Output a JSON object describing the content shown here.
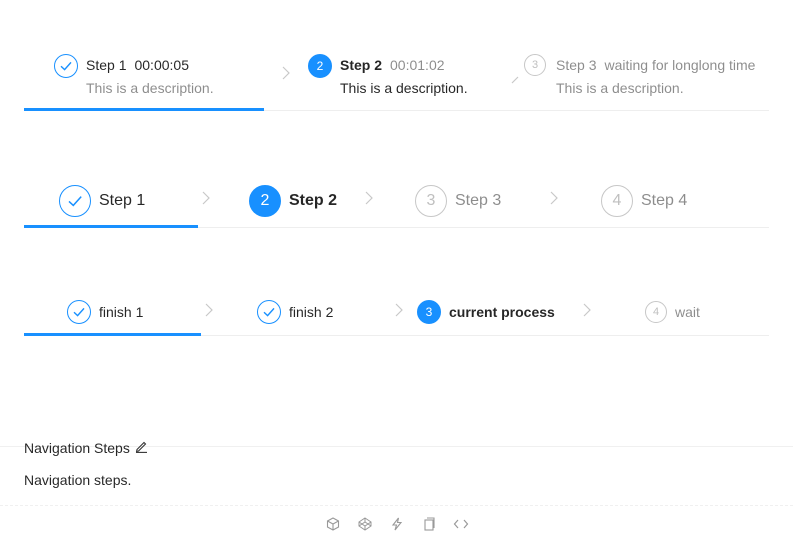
{
  "colors": {
    "primary": "#1890ff",
    "wait": "#bfbfbf",
    "divider": "#eeeeee"
  },
  "row1": {
    "steps": [
      {
        "status": "finish",
        "title": "Step 1",
        "subtitle": "00:00:05",
        "description": "This is a description.",
        "icon": "check-icon"
      },
      {
        "status": "process",
        "number": "2",
        "title": "Step 2",
        "subtitle": "00:01:02",
        "description": "This is a description."
      },
      {
        "status": "wait",
        "number": "3",
        "title": "Step 3",
        "subtitle": "waiting for longlong time",
        "description": "This is a description."
      }
    ]
  },
  "row2": {
    "steps": [
      {
        "status": "finish",
        "title": "Step 1",
        "icon": "check-icon"
      },
      {
        "status": "process",
        "number": "2",
        "title": "Step 2"
      },
      {
        "status": "wait",
        "number": "3",
        "title": "Step 3"
      },
      {
        "status": "wait",
        "number": "4",
        "title": "Step 4"
      }
    ]
  },
  "row3": {
    "steps": [
      {
        "status": "finish",
        "title": "finish 1",
        "icon": "check-icon"
      },
      {
        "status": "finish",
        "title": "finish 2",
        "icon": "check-icon"
      },
      {
        "status": "process",
        "number": "3",
        "title": "current process"
      },
      {
        "status": "wait",
        "number": "4",
        "title": "wait"
      }
    ]
  },
  "demo": {
    "title": "Navigation Steps",
    "description": "Navigation steps.",
    "actions": [
      "codesandbox-icon",
      "codepen-icon",
      "stackblitz-icon",
      "copy-icon",
      "code-icon"
    ]
  }
}
